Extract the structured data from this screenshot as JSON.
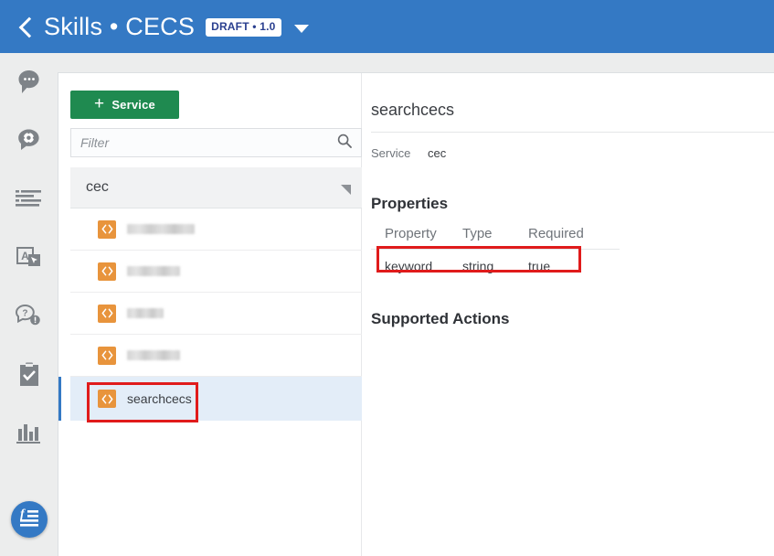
{
  "header": {
    "back_icon": "back-chevron-icon",
    "title": "Skills • CECS",
    "badge": "DRAFT • 1.0",
    "caret_icon": "chevron-down-icon"
  },
  "rail": {
    "items": [
      {
        "icon": "head-speech-bubble-icon"
      },
      {
        "icon": "gear-speech-bubble-icon"
      },
      {
        "icon": "text-lines-icon"
      },
      {
        "icon": "translate-icon"
      },
      {
        "icon": "question-speech-bubble-icon"
      },
      {
        "icon": "clipboard-check-icon"
      },
      {
        "icon": "bar-chart-icon"
      }
    ],
    "fab": {
      "icon": "formula-document-icon"
    }
  },
  "list_panel": {
    "add_button": {
      "plus": "+",
      "label": "Service",
      "icon": "plus-icon"
    },
    "filter": {
      "value": "",
      "placeholder": "Filter",
      "icon": "search-icon"
    },
    "group": {
      "label": "cec",
      "collapse_icon": "corner-triangle-icon"
    },
    "items": [
      {
        "label": "",
        "redacted": true,
        "icon": "code-brackets-icon",
        "selected": false
      },
      {
        "label": "",
        "redacted": true,
        "icon": "code-brackets-icon",
        "selected": false
      },
      {
        "label": "",
        "redacted": true,
        "icon": "code-brackets-icon",
        "selected": false
      },
      {
        "label": "",
        "redacted": true,
        "icon": "code-brackets-icon",
        "selected": false
      },
      {
        "label": "searchcecs",
        "redacted": false,
        "icon": "code-brackets-icon",
        "selected": true
      }
    ]
  },
  "detail": {
    "title": "searchcecs",
    "service_key": "Service",
    "service_value": "cec",
    "properties_heading": "Properties",
    "properties_columns": [
      "Property",
      "Type",
      "Required"
    ],
    "properties_rows": [
      {
        "property": "keyword",
        "type": "string",
        "required": "true"
      }
    ],
    "supported_actions_heading": "Supported Actions"
  },
  "colors": {
    "header_blue": "#3479c4",
    "accent_green": "#1f8a50",
    "code_orange": "#e8943c",
    "selected_blue": "#e3edf8",
    "annotation_red": "#e01b1b"
  }
}
